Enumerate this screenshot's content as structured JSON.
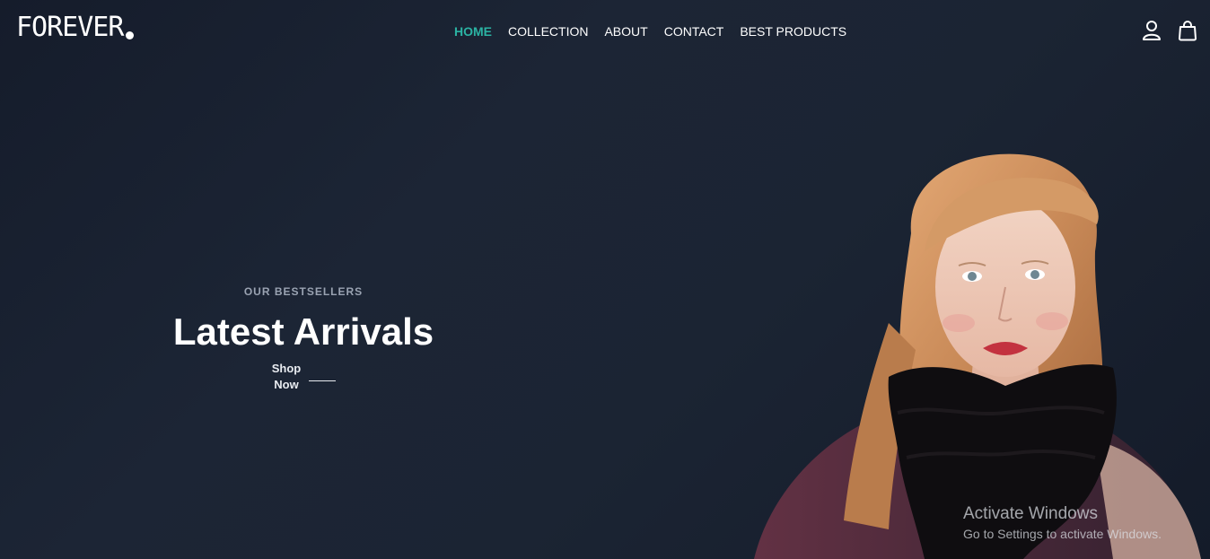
{
  "header": {
    "logo_text": "FOREVER",
    "nav": [
      {
        "label": "HOME",
        "active": true
      },
      {
        "label": "COLLECTION",
        "active": false
      },
      {
        "label": "ABOUT",
        "active": false
      },
      {
        "label": "CONTACT",
        "active": false
      },
      {
        "label": "BEST PRODUCTS",
        "active": false
      }
    ],
    "icons": [
      "user-icon",
      "shopping-bag-icon"
    ]
  },
  "hero": {
    "eyebrow": "OUR BESTSELLERS",
    "headline": "Latest Arrivals",
    "cta_label": "Shop Now",
    "image": "model-portrait"
  },
  "watermark": {
    "title": "Activate Windows",
    "subtitle": "Go to Settings to activate Windows."
  },
  "colors": {
    "background": "#1b2433",
    "accent": "#2bb3a3",
    "text": "#ffffff"
  }
}
